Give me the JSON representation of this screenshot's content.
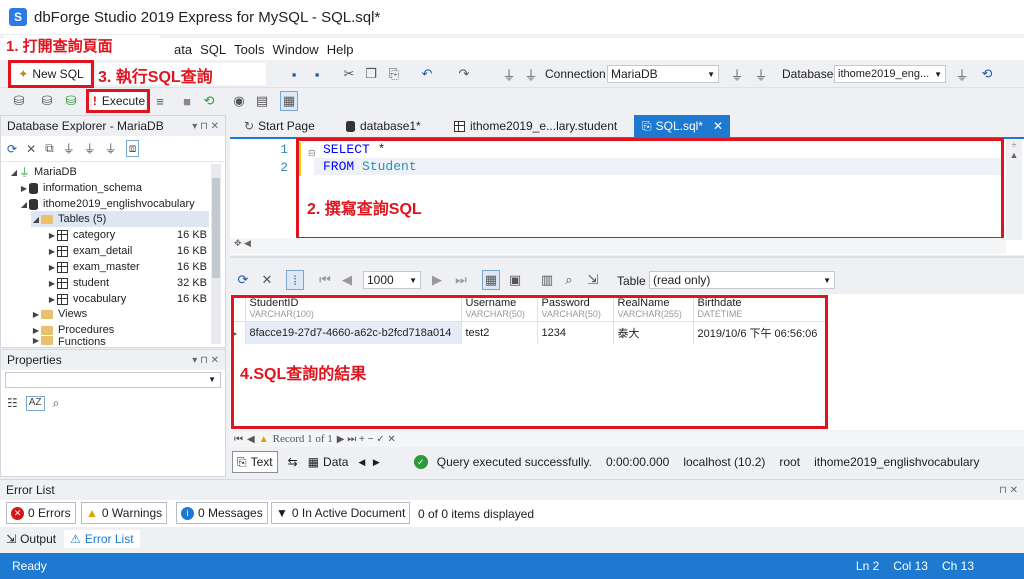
{
  "app": {
    "title": "dbForge Studio 2019 Express for MySQL - SQL.sql*"
  },
  "menu": {
    "items": [
      "ata",
      "SQL",
      "Tools",
      "Window",
      "Help"
    ]
  },
  "toolbar": {
    "new_sql": "New SQL",
    "execute": "Execute",
    "connection_label": "Connection",
    "connection_value": "MariaDB",
    "database_label": "Database",
    "database_value": "ithome2019_eng..."
  },
  "annotations": {
    "step1": "1. 打開查詢頁面",
    "step2": "2. 撰寫查詢SQL",
    "step3": "3. 執行SQL查詢",
    "step4": "4.SQL查詢的結果"
  },
  "explorer": {
    "title": "Database Explorer - MariaDB",
    "root": "MariaDB",
    "db1": "information_schema",
    "db2": "ithome2019_englishvocabulary",
    "tables_folder": "Tables (5)",
    "tables": [
      {
        "name": "category",
        "size": "16 KB"
      },
      {
        "name": "exam_detail",
        "size": "16 KB"
      },
      {
        "name": "exam_master",
        "size": "16 KB"
      },
      {
        "name": "student",
        "size": "32 KB"
      },
      {
        "name": "vocabulary",
        "size": "16 KB"
      }
    ],
    "views": "Views",
    "procedures": "Procedures",
    "functions": "Functions"
  },
  "properties": {
    "title": "Properties"
  },
  "tabs": [
    "Start Page",
    "database1*",
    "ithome2019_e...lary.student",
    "SQL.sql*"
  ],
  "editor": {
    "line_numbers": [
      "1",
      "2"
    ],
    "line1_kw": "SELECT",
    "line1_rest": " *",
    "line2_kw": "FROM",
    "line2_ident": " Student"
  },
  "results_toolbar": {
    "page_size": "1000",
    "table_label": "Table",
    "table_mode": "(read only)"
  },
  "grid": {
    "columns": [
      {
        "name": "StudentID",
        "type": "VARCHAR(100)"
      },
      {
        "name": "Username",
        "type": "VARCHAR(50)"
      },
      {
        "name": "Password",
        "type": "VARCHAR(50)"
      },
      {
        "name": "RealName",
        "type": "VARCHAR(255)"
      },
      {
        "name": "Birthdate",
        "type": "DATETIME"
      }
    ],
    "row": [
      "8facce19-27d7-4660-a62c-b2fcd718a014",
      "test2",
      "1234",
      "泰大",
      "2019/10/6 下午 06:56:06"
    ]
  },
  "record_nav": {
    "text": "Record 1 of 1"
  },
  "bottom_bar": {
    "text_tab": "Text",
    "data_tab": "Data",
    "status": "Query executed successfully.",
    "time": "0:00:00.000",
    "host": "localhost (10.2)",
    "user": "root",
    "db": "ithome2019_englishvocabulary"
  },
  "error_list": {
    "title": "Error List",
    "errors": "0 Errors",
    "warnings": "0 Warnings",
    "messages": "0 Messages",
    "in_doc": "0 In Active Document",
    "summary": "0 of 0 items displayed"
  },
  "output_tabs": {
    "output": "Output",
    "error_list": "Error List"
  },
  "status_bar": {
    "ready": "Ready",
    "ln": "Ln 2",
    "col": "Col 13",
    "ch": "Ch 13"
  },
  "colors": {
    "accent": "#1e7ad0",
    "annotation": "#e0141e"
  }
}
